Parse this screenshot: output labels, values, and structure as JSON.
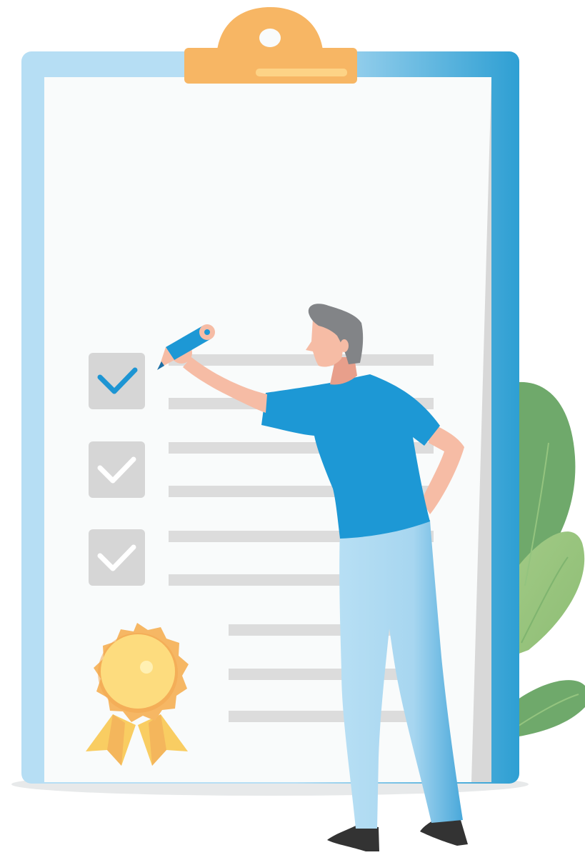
{
  "illustration": {
    "subject": "clipboard-checklist-with-man",
    "checklist": {
      "items": [
        {
          "checked": true,
          "state": "active"
        },
        {
          "checked": true,
          "state": "done"
        },
        {
          "checked": true,
          "state": "done"
        }
      ],
      "badge": "award-rosette-icon"
    },
    "colors": {
      "clipboard_light": "#b6def4",
      "clipboard_dark": "#2e9fd3",
      "paper": "#f9fbfb",
      "paper_shadow": "#d8d8d8",
      "clip": "#f7b664",
      "clip_highlight": "#fdd386",
      "line": "#dcdcdc",
      "checkbox": "#d6d6d6",
      "check_active": "#1d95d3",
      "check_done": "#ffffff",
      "medal_outer": "#f6b764",
      "medal_inner": "#fddc7e",
      "shirt": "#1d98d5",
      "skin": "#f6bca5",
      "hair": "#828487",
      "pants_light": "#b7dff4",
      "pants_dark": "#49a8da",
      "shoe": "#333333",
      "leaf_dark": "#6fa96b",
      "leaf_light": "#a3cb87",
      "ground_shadow": "#e7e9ea"
    }
  }
}
